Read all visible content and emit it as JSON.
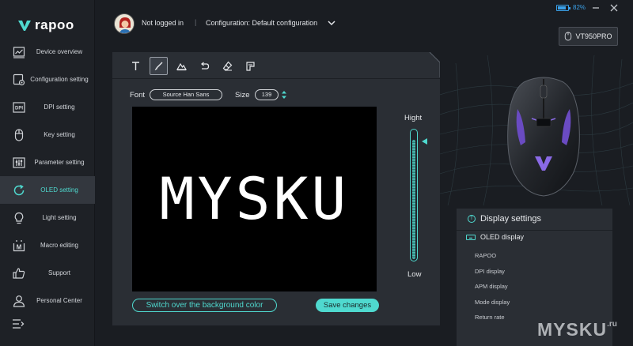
{
  "app": {
    "logo_text": "rapoo"
  },
  "sidebar": {
    "items": [
      {
        "label": "Device overview",
        "icon": "chart-line-icon",
        "active": false
      },
      {
        "label": "Configuration setting",
        "icon": "config-gear-icon",
        "active": false
      },
      {
        "label": "DPI setting",
        "icon": "dpi-icon",
        "active": false
      },
      {
        "label": "Key setting",
        "icon": "mouse-icon",
        "active": false
      },
      {
        "label": "Parameter setting",
        "icon": "sliders-icon",
        "active": false
      },
      {
        "label": "OLED setting",
        "icon": "oled-refresh-icon",
        "active": true
      },
      {
        "label": "Light setting",
        "icon": "bulb-icon",
        "active": false
      },
      {
        "label": "Macro editing",
        "icon": "macro-icon",
        "active": false
      },
      {
        "label": "Support",
        "icon": "thumbs-up-icon",
        "active": false
      },
      {
        "label": "Personal Center",
        "icon": "person-icon",
        "active": false
      }
    ],
    "collapse_icon": "menu-collapse-icon"
  },
  "header": {
    "user_status": "Not logged in",
    "separator": "|",
    "configuration": "Configuration: Default configuration",
    "battery_percent": "82%",
    "battery_level": 0.82,
    "device_name": "VT950PRO"
  },
  "editor": {
    "tools": [
      {
        "name": "text-tool-icon",
        "active": false
      },
      {
        "name": "brush-tool-icon",
        "active": true
      },
      {
        "name": "image-tool-icon",
        "active": false
      },
      {
        "name": "undo-icon",
        "active": false
      },
      {
        "name": "eraser-icon",
        "active": false
      },
      {
        "name": "format-icon",
        "active": false
      }
    ],
    "font_label": "Font",
    "font_value": "Source Han Sans",
    "size_label": "Size",
    "size_value": "139",
    "canvas_text": "MYSKU",
    "brightness_high": "Hight",
    "brightness_low": "Low",
    "brightness_level": 0.92,
    "switch_bg_label": "Switch over the background color",
    "save_label": "Save changes"
  },
  "display_settings": {
    "title": "Display settings",
    "section_label": "OLED display",
    "items": [
      "RAPOO",
      "DPI display",
      "APM display",
      "Mode display",
      "Return rate"
    ]
  },
  "watermark": {
    "text": "MYSKU",
    "suffix": ".ru"
  },
  "colors": {
    "accent": "#4fd9cf",
    "battery": "#3aa0e8",
    "background": "#1a1d22"
  }
}
